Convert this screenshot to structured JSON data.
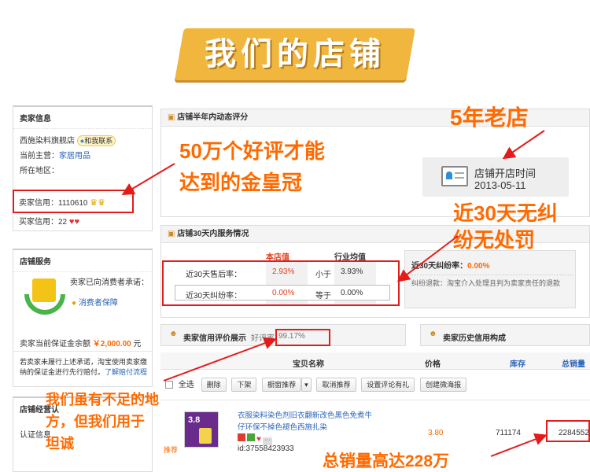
{
  "banner": {
    "title": "我们的店铺"
  },
  "seller_info": {
    "heading": "卖家信息",
    "shop_name": "西施染料旗舰店",
    "contact_label": "和我联系",
    "main_business_label": "当前主营：",
    "main_business_value": "家居用品",
    "region_label": "所在地区：",
    "credit_label": "卖家信用：",
    "credit_value": "1110610",
    "buyer_credit_label": "买家信用：",
    "buyer_credit_value": "22"
  },
  "shop_service": {
    "heading": "店铺服务",
    "promise_text": "卖家已向消费者承诺：",
    "guarantee_label": "消费者保障",
    "deposit_label": "卖家当前保证金余额",
    "deposit_value": "￥2,000.00",
    "deposit_unit": "元",
    "note_line1": "若卖家未履行上述承诺，淘宝使用卖家缴",
    "note_line2": "纳的保证金进行先行赔付。",
    "note_link": "了解赔付流程"
  },
  "shop_cert": {
    "heading": "店铺经营认",
    "cert_label": "认证信息"
  },
  "dynamic_rating": {
    "heading": "店铺半年内动态评分",
    "open_time_label": "店铺开店时间",
    "open_time_value": "2013-05-11"
  },
  "service_status": {
    "heading": "店铺30天内服务情况",
    "col_shop": "本店值",
    "col_industry": "行业均值",
    "rows": [
      {
        "label": "近30天售后率：",
        "shop": "2.93%",
        "cmp": "小于",
        "industry": "3.93%"
      },
      {
        "label": "近30天纠纷率：",
        "shop": "0.00%",
        "cmp": "等于",
        "industry": "0.00%"
      }
    ],
    "dispute_label": "近30天纠纷率：",
    "dispute_value": "0.00%",
    "dispute_note": "纠纷退款：淘宝介入处理且判为卖家责任的退款"
  },
  "credit_display": {
    "heading": "卖家信用评价展示",
    "rate_label": "好评率：",
    "rate_value": "99.17%",
    "history_heading": "卖家历史信用构成"
  },
  "product_table": {
    "col_name": "宝贝名称",
    "col_price": "价格",
    "col_stock": "库存",
    "col_sales": "总销量",
    "select_all": "全选",
    "toolbar": [
      "删除",
      "下架",
      "橱窗推荐",
      "取消推荐",
      "设置评论有礼",
      "创建微海报"
    ],
    "recommend_tag": "推荐",
    "product": {
      "title_line1": "衣服染料染色剂旧衣翻新改色黑色免煮牛",
      "title_line2": "仔环保不掉色褪色西施扎染",
      "id": "id:37558423933",
      "price": "3.80",
      "stock": "711174",
      "sales": "2284552",
      "thumb_text": "3.8"
    }
  },
  "annotations": {
    "crown_line1": "50万个好评才能",
    "crown_line2": "达到的金皇冠",
    "old_shop": "5年老店",
    "no_dispute_line1": "近30天无纠",
    "no_dispute_line2": "纷无处罚",
    "effort_line1": "我们虽有不足的地",
    "effort_line2": "方，但我们用于",
    "effort_line3": "坦诚",
    "sales_total": "总销量高达228万"
  },
  "colors": {
    "annotation": "#ff6a00",
    "highlight_box": "#e41b1b",
    "banner": "#f1b63e",
    "link": "#2a64b8"
  }
}
